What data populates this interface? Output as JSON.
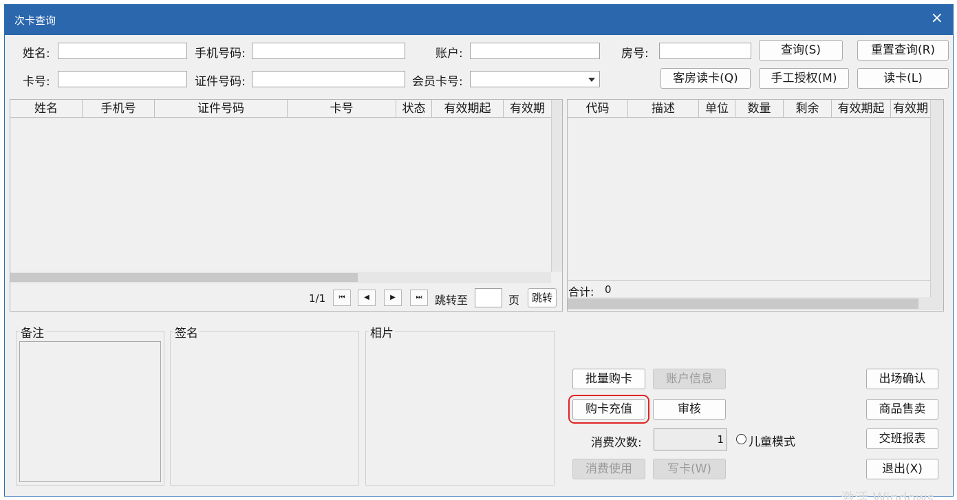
{
  "window": {
    "title": "次卡查询",
    "close_glyph": "×"
  },
  "filters": {
    "name_label": "姓名:",
    "phone_label": "手机号码:",
    "account_label": "账户:",
    "room_label": "房号:",
    "card_no_label": "卡号:",
    "id_no_label": "证件号码:",
    "member_card_label": "会员卡号:",
    "name_value": "",
    "phone_value": "",
    "account_value": "",
    "room_value": "",
    "card_no_value": "",
    "id_no_value": "",
    "member_card_value": ""
  },
  "toolbar": {
    "query_label": "查询(S)",
    "reset_label": "重置查询(R)",
    "guest_read_label": "客房读卡(Q)",
    "manual_auth_label": "手工授权(M)",
    "read_card_label": "读卡(L)"
  },
  "left_table": {
    "columns": [
      "姓名",
      "手机号",
      "证件号码",
      "卡号",
      "状态",
      "有效期起",
      "有效期"
    ],
    "rows": []
  },
  "pager": {
    "page_info": "1/1",
    "first_glyph": "⏮",
    "prev_glyph": "◀",
    "next_glyph": "▶",
    "last_glyph": "⏭",
    "jump_to_label": "跳转至",
    "page_value": "",
    "page_unit_label": "页",
    "jump_button_label": "跳转"
  },
  "right_table": {
    "columns": [
      "代码",
      "描述",
      "单位",
      "数量",
      "剩余",
      "有效期起",
      "有效期"
    ],
    "rows": [],
    "total_label": "合计:",
    "total_value": "0"
  },
  "panels": {
    "remark_label": "备注",
    "signature_label": "签名",
    "photo_label": "相片"
  },
  "actions": {
    "batch_buy_label": "批量购卡",
    "account_info_label": "账户信息",
    "buy_recharge_label": "购卡充值",
    "audit_label": "审核",
    "consume_count_label": "消费次数:",
    "consume_count_value": "1",
    "child_mode_label": "儿童模式",
    "consume_use_label": "消费使用",
    "write_card_label": "写卡(W)",
    "exit_confirm_label": "出场确认",
    "goods_sale_label": "商品售卖",
    "shift_report_label": "交班报表",
    "exit_label": "退出(X)"
  },
  "watermark_text": "激活 Windows"
}
